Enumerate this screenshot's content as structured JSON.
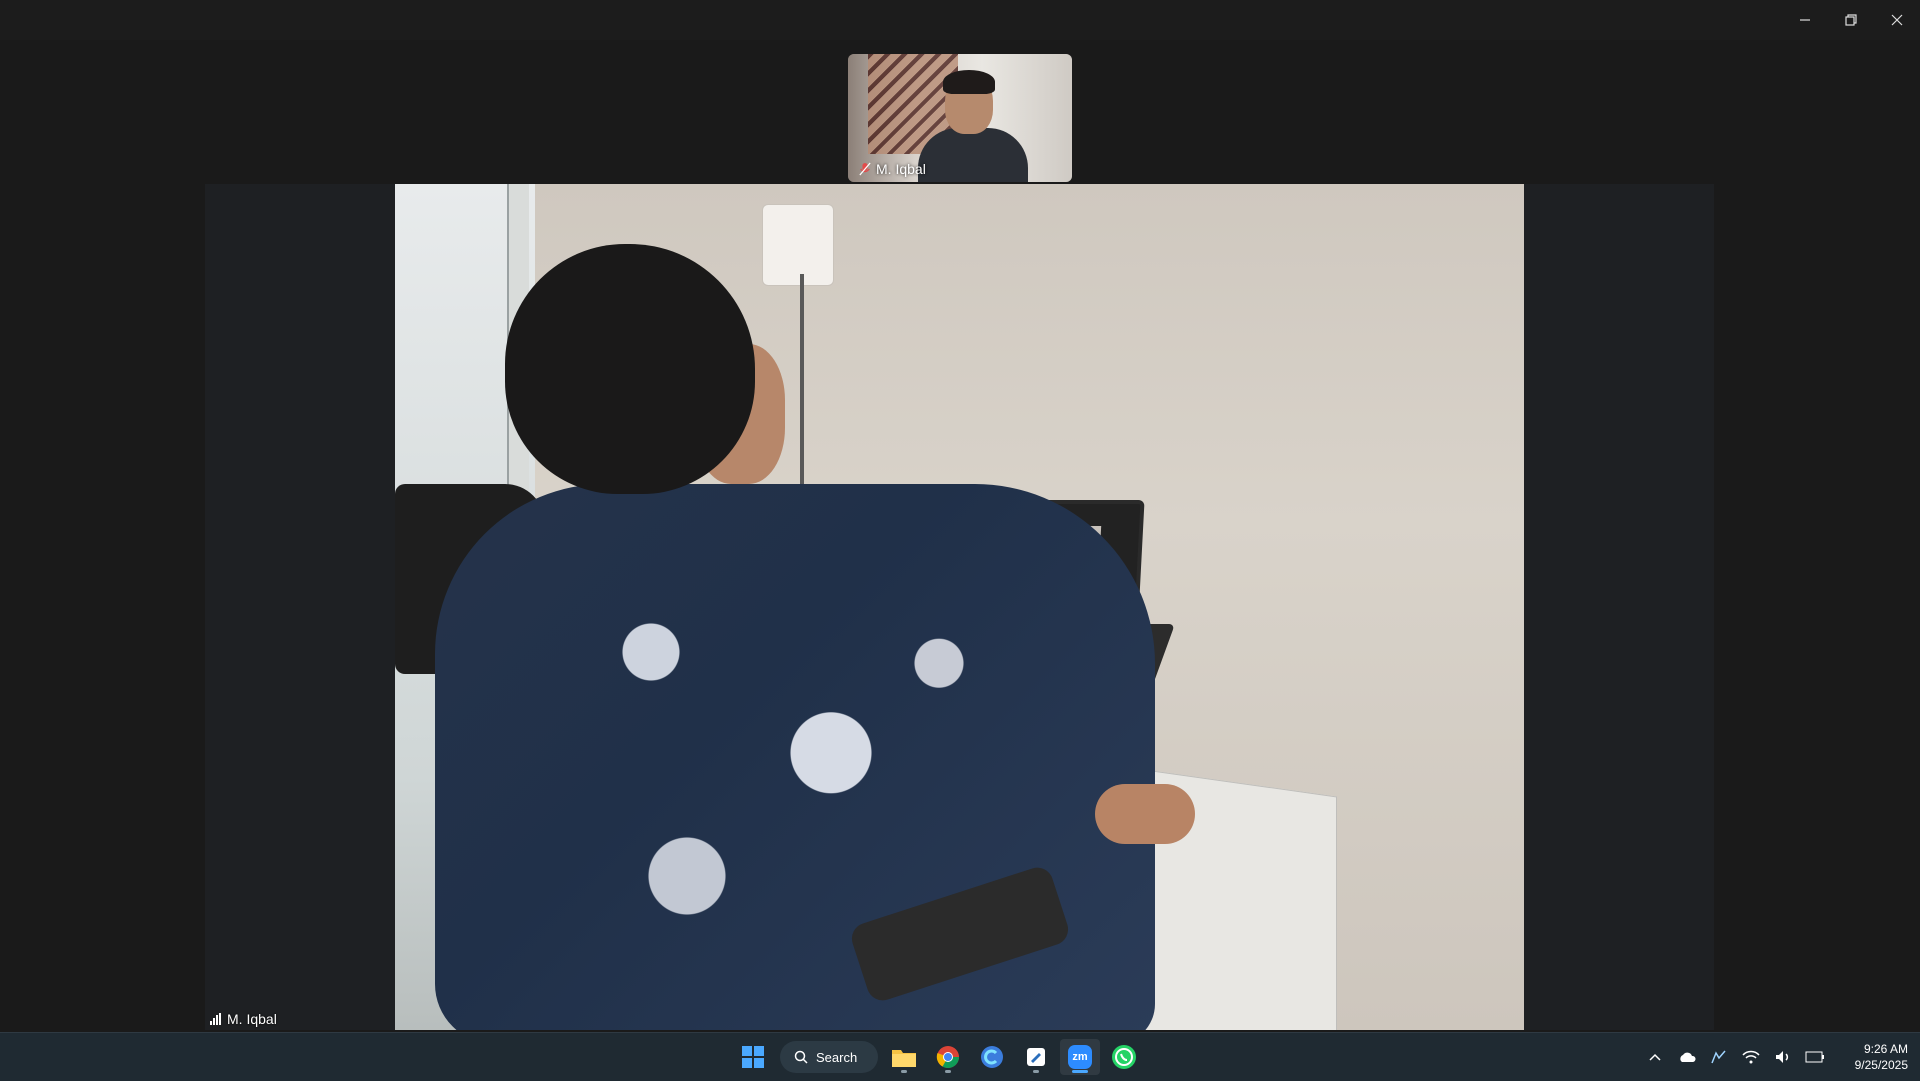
{
  "titlebar": {
    "buttons": [
      "minimize-icon",
      "restore-icon",
      "close-icon"
    ]
  },
  "video": {
    "self_view_name": "M. Iqbal",
    "main_participant_name": "M. Iqbal"
  },
  "taskbar": {
    "search_label": "Search",
    "pinned": [
      {
        "name": "windows-start-icon"
      },
      {
        "name": "file-explorer-icon"
      },
      {
        "name": "chrome-icon"
      },
      {
        "name": "copilot-icon"
      },
      {
        "name": "notepad-icon"
      },
      {
        "name": "zoom-icon",
        "label": "zm"
      },
      {
        "name": "whatsapp-icon"
      }
    ],
    "tray": {
      "time": "9:26 AM",
      "date": "9/25/2025"
    }
  },
  "colors": {
    "accent": "#4aa8ff",
    "muted_mic": "#e24b4b"
  }
}
